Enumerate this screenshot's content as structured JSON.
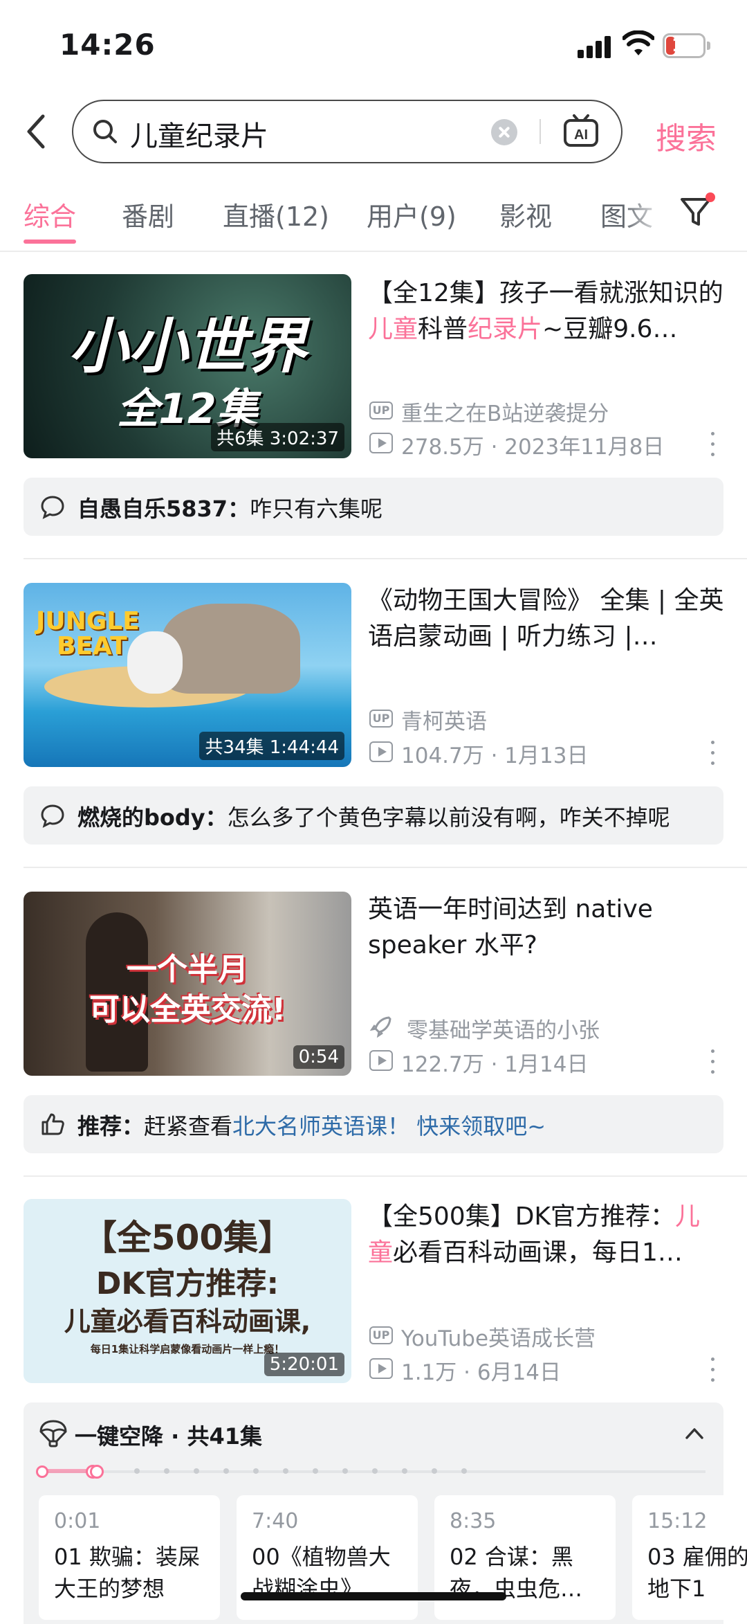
{
  "status_bar": {
    "time": "14:26",
    "battery": "18"
  },
  "search": {
    "query": "儿童纪录片",
    "button": "搜索"
  },
  "tabs": [
    "综合",
    "番剧",
    "直播(12)",
    "用户(9)",
    "影视",
    "图文"
  ],
  "results": [
    {
      "title_parts": [
        {
          "t": "【全12集】孩子一看就涨知识的",
          "hl": false
        },
        {
          "t": "儿童",
          "hl": true
        },
        {
          "t": "科普",
          "hl": false
        },
        {
          "t": "纪录片",
          "hl": true
        },
        {
          "t": "~豆瓣9.6…",
          "hl": false
        }
      ],
      "thumb_text": [
        "小小世界",
        "全12集"
      ],
      "badge": "共6集 3:02:37",
      "uploader": "重生之在B站逆袭提分",
      "stats": "278.5万 · 2023年11月8日",
      "comment": {
        "user": "自愚自乐5837：",
        "text": "咋只有六集呢"
      }
    },
    {
      "title_parts": [
        {
          "t": "《动物王国大冒险》 全集 | 全英语启蒙动画 | 听力练习 |…",
          "hl": false
        }
      ],
      "thumb_text": [
        "JUNGLE",
        "BEAT"
      ],
      "badge": "共34集 1:44:44",
      "uploader": "青柯英语",
      "stats": "104.7万 · 1月13日",
      "comment": {
        "user": "燃烧的body：",
        "text": "怎么多了个黄色字幕以前没有啊，咋关不掉呢"
      }
    },
    {
      "title_parts": [
        {
          "t": "英语一年时间达到 native speaker 水平?",
          "hl": false
        }
      ],
      "thumb_text": [
        "一个半月",
        "可以全英交流!"
      ],
      "badge": "0:54",
      "uploader": "零基础学英语的小张",
      "stats": "122.7万 · 1月14日",
      "comment": {
        "user": "推荐：",
        "text": "赶紧查看",
        "link": "北大名师英语课！ 快来领取吧~"
      }
    },
    {
      "title_parts": [
        {
          "t": "【全500集】DK官方推荐：",
          "hl": false
        },
        {
          "t": "儿童",
          "hl": true
        },
        {
          "t": "必看百科动画课，每日1…",
          "hl": false
        }
      ],
      "thumb_text": [
        "【全500集】",
        "DK官方推荐:",
        "儿童必看百科动画课,",
        "每日1集让科学启蒙像看动画片一样上瘾！"
      ],
      "badge": "5:20:01",
      "uploader": "YouTube英语成长营",
      "stats": "1.1万 · 6月14日"
    }
  ],
  "collection": {
    "title": "一键空降 · 共41集",
    "episodes": [
      {
        "time": "0:01",
        "title": "01 欺骗：装屎大王的梦想"
      },
      {
        "time": "7:40",
        "title": "00《植物兽大战糊涂虫》…"
      },
      {
        "time": "8:35",
        "title": "02 合谋：黑夜，虫虫危…"
      },
      {
        "time": "15:12",
        "title": "03 雇佣的地下1"
      }
    ]
  },
  "colors": {
    "accent": "#fb7299",
    "link": "#2e6ba8",
    "meta": "#9499a0"
  }
}
